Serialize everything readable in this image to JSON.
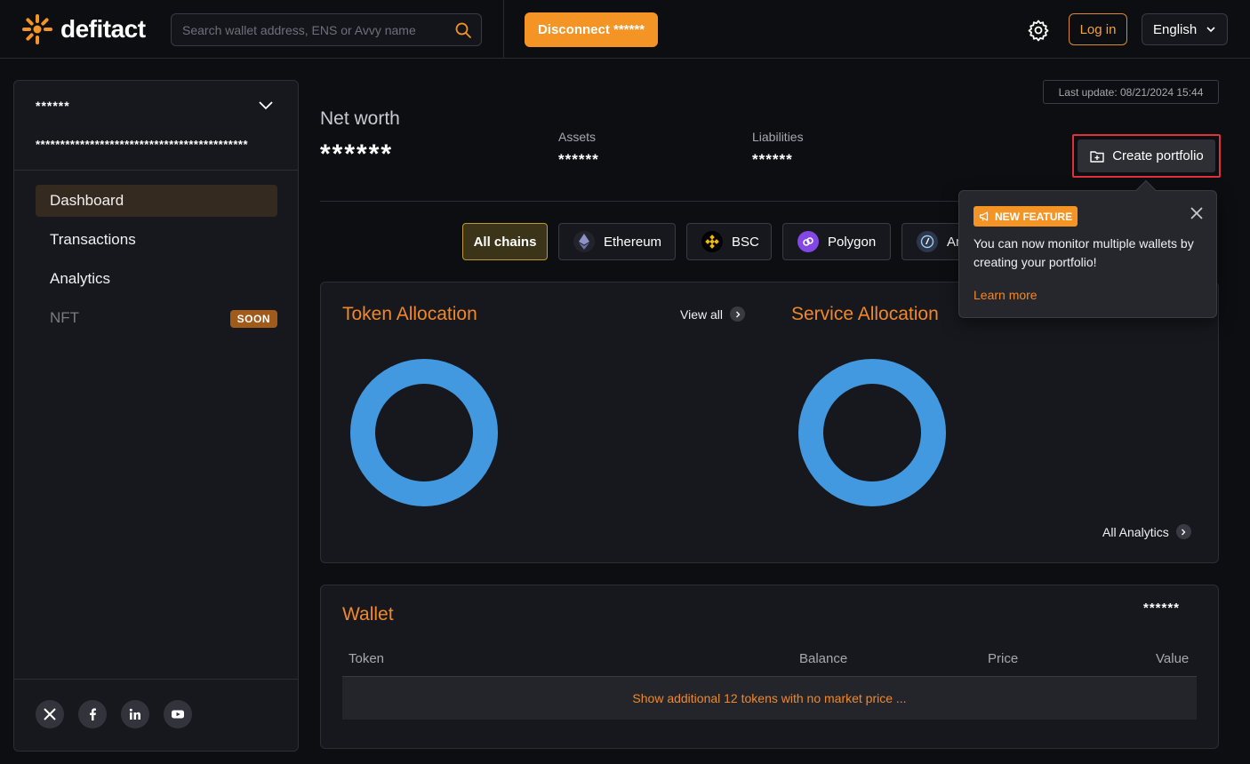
{
  "header": {
    "brand": "defitact",
    "search_placeholder": "Search wallet address, ENS or Avvy name",
    "disconnect_label": "Disconnect ******",
    "login_label": "Log in",
    "language": "English"
  },
  "sidebar": {
    "account_name": "******",
    "account_address": "*******************************************",
    "nav": [
      {
        "label": "Dashboard",
        "active": true
      },
      {
        "label": "Transactions"
      },
      {
        "label": "Analytics"
      },
      {
        "label": "NFT",
        "badge": "SOON"
      }
    ],
    "socials": [
      "x-icon",
      "facebook-icon",
      "linkedin-icon",
      "youtube-icon"
    ]
  },
  "summary": {
    "last_update": "Last update: 08/21/2024 15:44",
    "networth_label": "Net worth",
    "networth_value": "******",
    "assets_label": "Assets",
    "assets_value": "******",
    "liabilities_label": "Liabilities",
    "liabilities_value": "******",
    "create_portfolio_label": "Create portfolio"
  },
  "chains": [
    {
      "label": "All chains",
      "active": true
    },
    {
      "label": "Ethereum",
      "icon": "ethereum-icon"
    },
    {
      "label": "BSC",
      "icon": "bsc-icon"
    },
    {
      "label": "Polygon",
      "icon": "polygon-icon"
    },
    {
      "label": "Arbitrum",
      "icon": "arbitrum-icon"
    }
  ],
  "allocation": {
    "token_title": "Token Allocation",
    "view_all": "View all",
    "service_title": "Service Allocation",
    "all_analytics": "All Analytics",
    "donut_color": "#4399e0"
  },
  "wallet": {
    "title": "Wallet",
    "total": "******",
    "columns": [
      "Token",
      "Balance",
      "Price",
      "Value"
    ],
    "more_tokens": "Show additional 12 tokens with no market price ..."
  },
  "tooltip": {
    "badge": "NEW FEATURE",
    "text": "You can now monitor multiple wallets by creating your portfolio!",
    "link": "Learn more"
  },
  "colors": {
    "accent": "#f39425",
    "title_orange": "#f0882a",
    "highlight_border": "#e0303b"
  }
}
